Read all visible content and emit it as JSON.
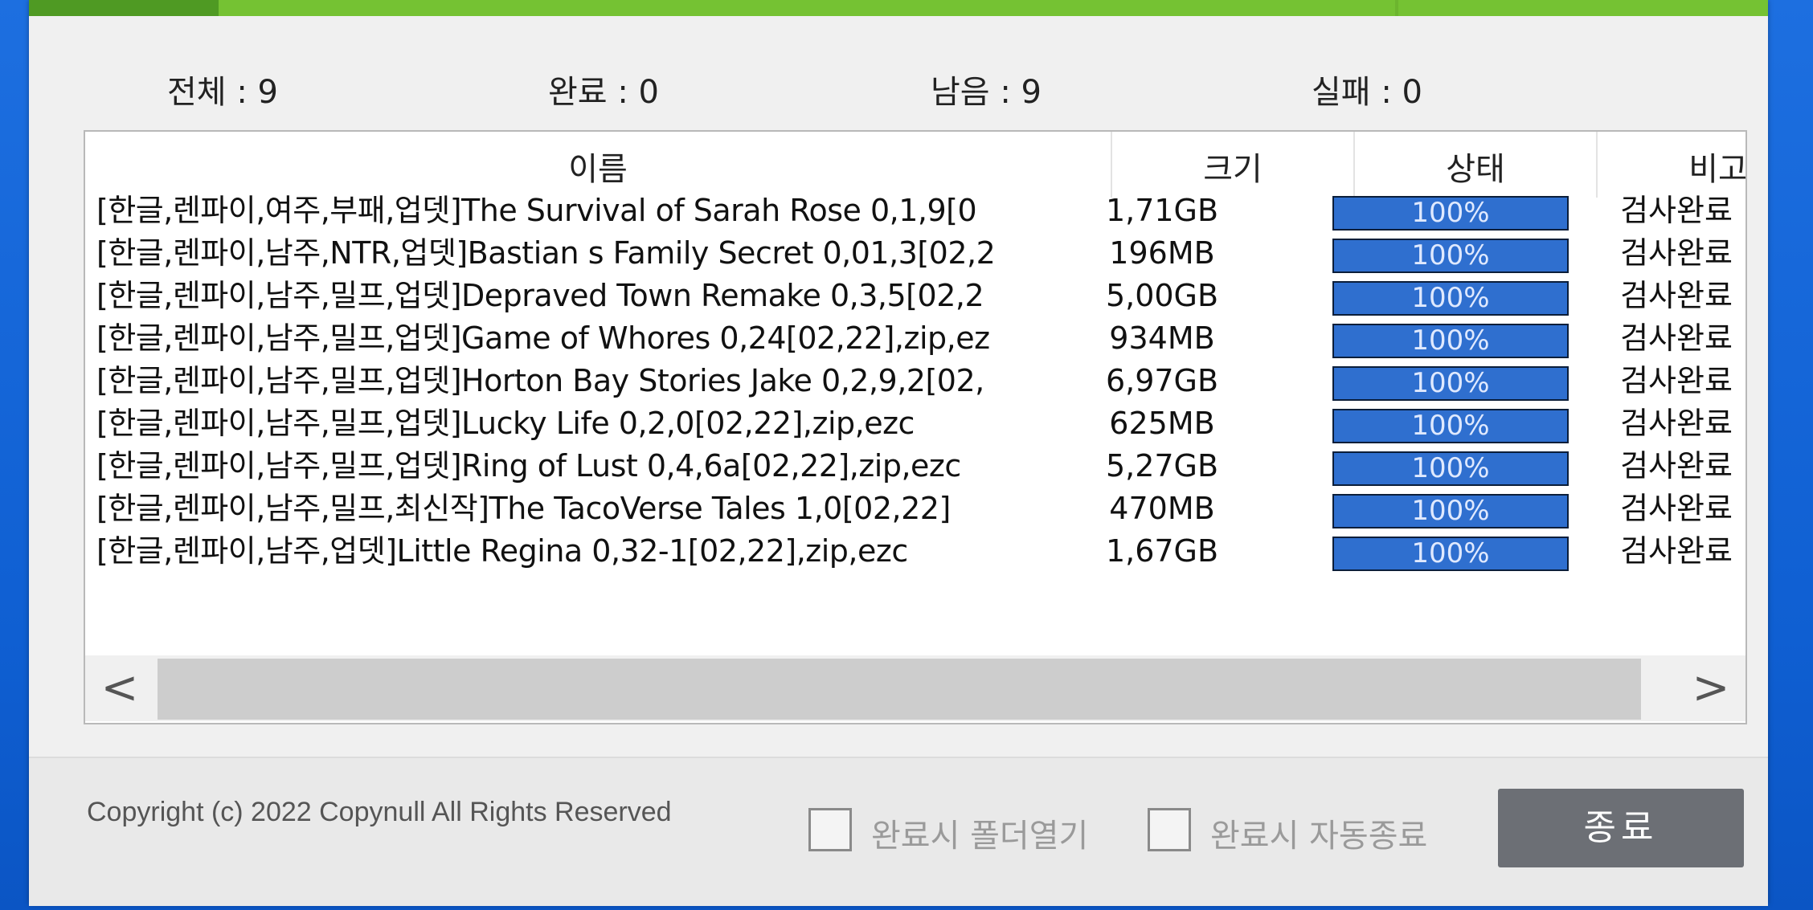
{
  "top_progress": {
    "percent": 100
  },
  "counters": [
    {
      "label": "전체 : 9"
    },
    {
      "label": "완료 : 0"
    },
    {
      "label": "남음 : 9"
    },
    {
      "label": "실패 : 0"
    }
  ],
  "table": {
    "headers": [
      "이름",
      "크기",
      "상태",
      "비고"
    ],
    "rows": [
      {
        "name": "[한글,렌파이,여주,부패,업뎃]The Survival of Sarah Rose 0,1,9[0",
        "size": "1,71GB",
        "status": "100%",
        "progress": 100,
        "note": "검사완료"
      },
      {
        "name": "[한글,렌파이,남주,NTR,업뎃]Bastian s Family Secret 0,01,3[02,2",
        "size": "196MB",
        "status": "100%",
        "progress": 100,
        "note": "검사완료"
      },
      {
        "name": "[한글,렌파이,남주,밀프,업뎃]Depraved Town Remake 0,3,5[02,2",
        "size": "5,00GB",
        "status": "100%",
        "progress": 100,
        "note": "검사완료"
      },
      {
        "name": "[한글,렌파이,남주,밀프,업뎃]Game of Whores 0,24[02,22],zip,ez",
        "size": "934MB",
        "status": "100%",
        "progress": 100,
        "note": "검사완료"
      },
      {
        "name": "[한글,렌파이,남주,밀프,업뎃]Horton Bay Stories Jake 0,2,9,2[02,",
        "size": "6,97GB",
        "status": "100%",
        "progress": 100,
        "note": "검사완료"
      },
      {
        "name": "[한글,렌파이,남주,밀프,업뎃]Lucky Life 0,2,0[02,22],zip,ezc",
        "size": "625MB",
        "status": "100%",
        "progress": 100,
        "note": "검사완료"
      },
      {
        "name": "[한글,렌파이,남주,밀프,업뎃]Ring of Lust 0,4,6a[02,22],zip,ezc",
        "size": "5,27GB",
        "status": "100%",
        "progress": 100,
        "note": "검사완료"
      },
      {
        "name": "[한글,렌파이,남주,밀프,최신작]The TacoVerse Tales 1,0[02,22]",
        "size": "470MB",
        "status": "100%",
        "progress": 100,
        "note": "검사완료"
      },
      {
        "name": "[한글,렌파이,남주,업뎃]Little Regina 0,32-1[02,22],zip,ezc",
        "size": "1,67GB",
        "status": "100%",
        "progress": 100,
        "note": "검사완료"
      }
    ]
  },
  "scrollbar": {
    "left_arrow": "<",
    "right_arrow": ">"
  },
  "footer": {
    "copyright": "Copyright (c) 2022 Copynull All Rights Reserved",
    "open_folder_label": "완료시 폴더열기",
    "auto_exit_label": "완료시 자동종료",
    "exit_label": "종료"
  },
  "colors": {
    "progress_green": "#75c233",
    "status_blue": "#2f6fcf",
    "button_gray": "#6c6f75"
  }
}
